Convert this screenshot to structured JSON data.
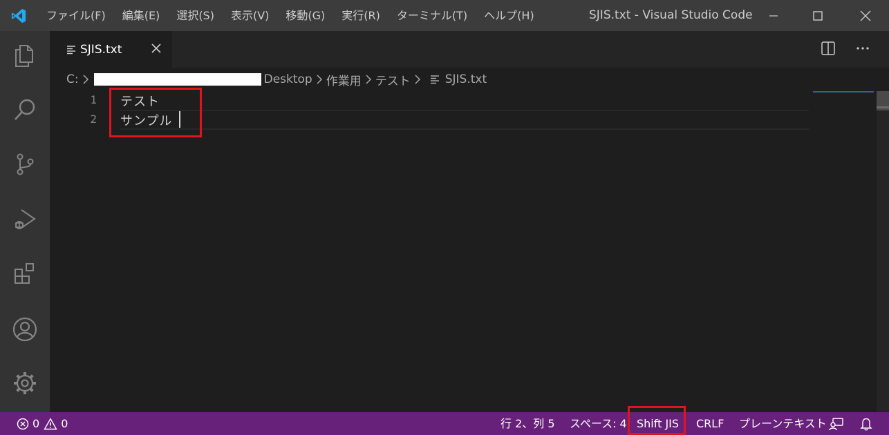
{
  "menu": [
    "ファイル(F)",
    "編集(E)",
    "選択(S)",
    "表示(V)",
    "移動(G)",
    "実行(R)",
    "ターミナル(T)",
    "ヘルプ(H)"
  ],
  "window_title": "SJIS.txt - Visual Studio Code",
  "tab": {
    "label": "SJIS.txt"
  },
  "breadcrumb": {
    "drive": "C:",
    "desktop": "Desktop",
    "folder1": "作業用",
    "folder2": "テスト",
    "file": "SJIS.txt"
  },
  "editor": {
    "line_numbers": [
      "1",
      "2"
    ],
    "lines": [
      "テスト",
      "サンプル"
    ],
    "cursor": {
      "line": 2,
      "column": 5
    }
  },
  "statusbar": {
    "errors": "0",
    "warnings": "0",
    "position": "行 2、列 5",
    "indent": "スペース: 4",
    "encoding": "Shift JIS",
    "eol": "CRLF",
    "language": "プレーンテキスト"
  },
  "colors": {
    "statusbar_bg": "#68217a",
    "highlight": "#e0141e",
    "vscode_blue": "#23a9f2"
  }
}
